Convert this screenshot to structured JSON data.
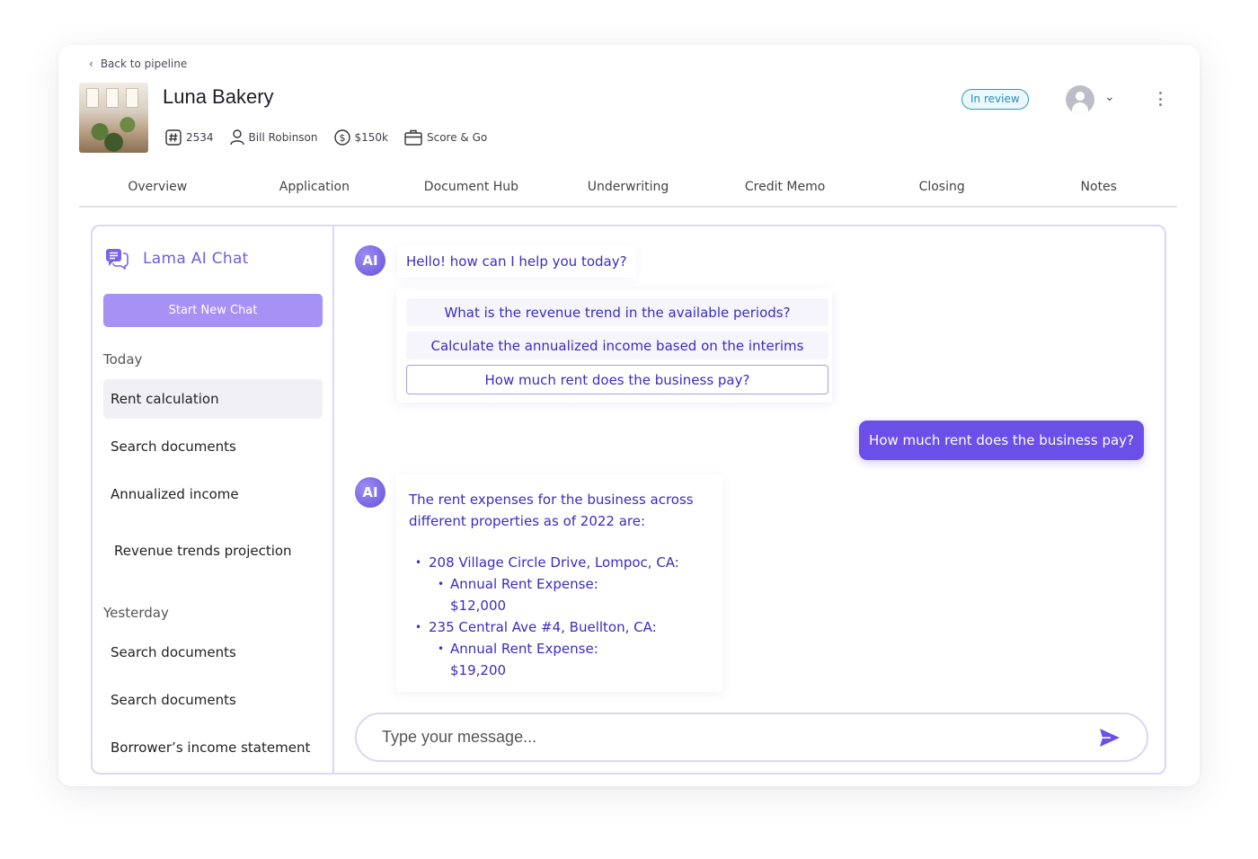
{
  "header": {
    "back_label": "Back to pipeline",
    "business_name": "Luna Bakery",
    "status": "In review",
    "meta": {
      "id": "2534",
      "owner": "Bill Robinson",
      "amount": "$150k",
      "product": "Score & Go"
    }
  },
  "tabs": [
    {
      "label": "Overview"
    },
    {
      "label": "Application"
    },
    {
      "label": "Document Hub"
    },
    {
      "label": "Underwriting"
    },
    {
      "label": "Credit Memo"
    },
    {
      "label": "Closing"
    },
    {
      "label": "Notes"
    }
  ],
  "sidebar": {
    "title": "Lama AI Chat",
    "new_chat_label": "Start New Chat",
    "today_label": "Today",
    "today_items": [
      {
        "label": "Rent calculation"
      },
      {
        "label": "Search documents"
      },
      {
        "label": "Annualized income"
      },
      {
        "label": "Revenue trends projection"
      }
    ],
    "yesterday_label": "Yesterday",
    "yesterday_items": [
      {
        "label": "Search documents"
      },
      {
        "label": "Search documents"
      },
      {
        "label": "Borrower’s income statement"
      }
    ]
  },
  "chat": {
    "ai_avatar_label": "AI",
    "greeting": "Hello! how can I help you today?",
    "suggestions": [
      {
        "label": "What is the revenue trend in the available periods?"
      },
      {
        "label": "Calculate the annualized income based on the interims"
      },
      {
        "label": "How much rent does the business pay?"
      }
    ],
    "user_message": "How much rent does the business pay?",
    "answer": {
      "intro": "The rent expenses for the business across different properties as of 2022 are:",
      "properties": [
        {
          "address": "208 Village Circle Drive, Lompoc, CA:",
          "expense_label": "Annual Rent Expense:",
          "expense_value": "$12,000"
        },
        {
          "address": "235 Central Ave #4, Buellton, CA:",
          "expense_label": "Annual Rent Expense:",
          "expense_value": "$19,200"
        }
      ]
    },
    "input": {
      "placeholder": "Type your message...",
      "value": ""
    }
  },
  "colors": {
    "accent": "#6b4fe8",
    "accent_light": "#a692f5",
    "text_accent": "#3c2cc2",
    "status": "#2a9cc7",
    "border": "#dcd7f4"
  }
}
